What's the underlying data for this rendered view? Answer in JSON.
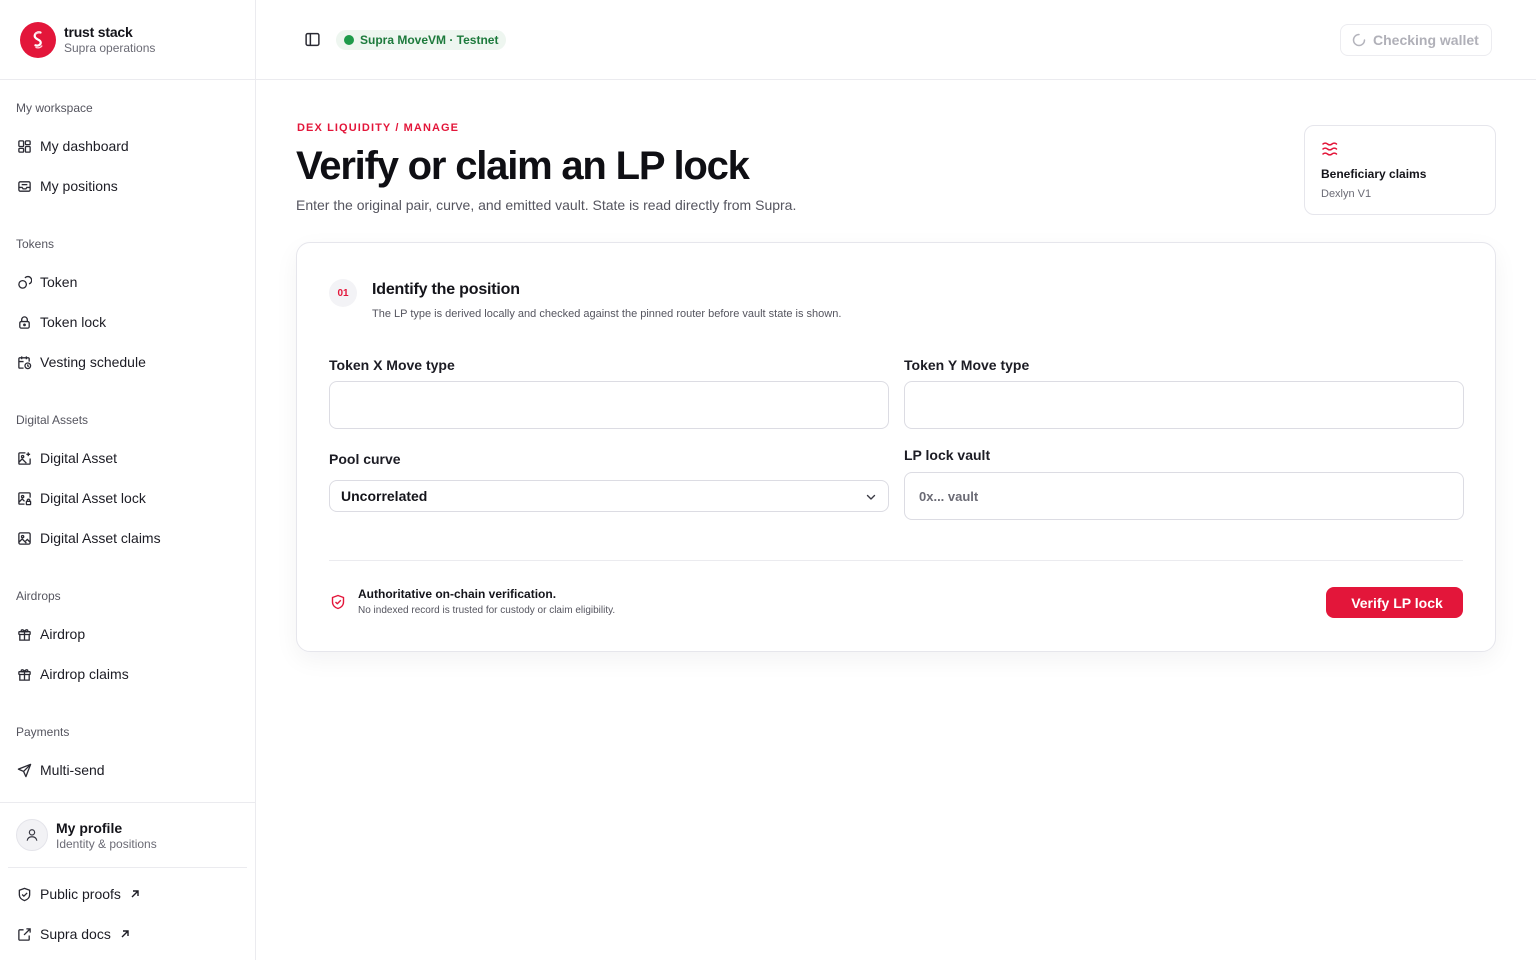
{
  "brand": {
    "name": "trust stack",
    "subtitle": "Supra operations"
  },
  "sidebar": {
    "sections": [
      {
        "label": "My workspace",
        "items": [
          {
            "label": "My dashboard",
            "icon": "dashboard-grid-icon"
          },
          {
            "label": "My positions",
            "icon": "inbox-icon"
          }
        ]
      },
      {
        "label": "Tokens",
        "items": [
          {
            "label": "Token",
            "icon": "coins-icon"
          },
          {
            "label": "Token lock",
            "icon": "lock-icon"
          },
          {
            "label": "Vesting schedule",
            "icon": "calendar-clock-icon"
          }
        ]
      },
      {
        "label": "Digital Assets",
        "items": [
          {
            "label": "Digital Asset",
            "icon": "image-plus-icon"
          },
          {
            "label": "Digital Asset lock",
            "icon": "image-lock-icon"
          },
          {
            "label": "Digital Asset claims",
            "icon": "image-icon"
          }
        ]
      },
      {
        "label": "Airdrops",
        "items": [
          {
            "label": "Airdrop",
            "icon": "gift-icon"
          },
          {
            "label": "Airdrop claims",
            "icon": "gift-icon"
          }
        ]
      },
      {
        "label": "Payments",
        "items": [
          {
            "label": "Multi-send",
            "icon": "send-icon"
          }
        ]
      }
    ],
    "profile": {
      "name": "My profile",
      "subtitle": "Identity & positions"
    },
    "footer_links": [
      {
        "label": "Public proofs",
        "icon": "shield-check-icon"
      },
      {
        "label": "Supra docs",
        "icon": "external-link-icon"
      }
    ]
  },
  "header": {
    "network": "Supra MoveVM · Testnet",
    "network_color": "#1e9a4a",
    "wallet_status": "Checking wallet"
  },
  "page": {
    "eyebrow": "DEX LIQUIDITY / MANAGE",
    "title": "Verify or claim an LP lock",
    "description": "Enter the original pair, curve, and emitted vault. State is read directly from Supra.",
    "accent_color": "#e3163a"
  },
  "claims_card": {
    "title": "Beneficiary claims",
    "subtitle": "Dexlyn V1",
    "icon": "waves-icon"
  },
  "form": {
    "step_number": "01",
    "step_title": "Identify the position",
    "step_description": "The LP type is derived locally and checked against the pinned router before vault state is shown.",
    "token_x": {
      "label": "Token X Move type",
      "value": "",
      "placeholder": ""
    },
    "token_y": {
      "label": "Token Y Move type",
      "value": "",
      "placeholder": ""
    },
    "pool_curve": {
      "label": "Pool curve",
      "selected": "Uncorrelated"
    },
    "vault": {
      "label": "LP lock vault",
      "value": "",
      "placeholder": "0x... vault"
    },
    "note_title": "Authoritative on-chain verification.",
    "note_description": "No indexed record is trusted for custody or claim eligibility.",
    "submit_label": "Verify LP lock"
  }
}
